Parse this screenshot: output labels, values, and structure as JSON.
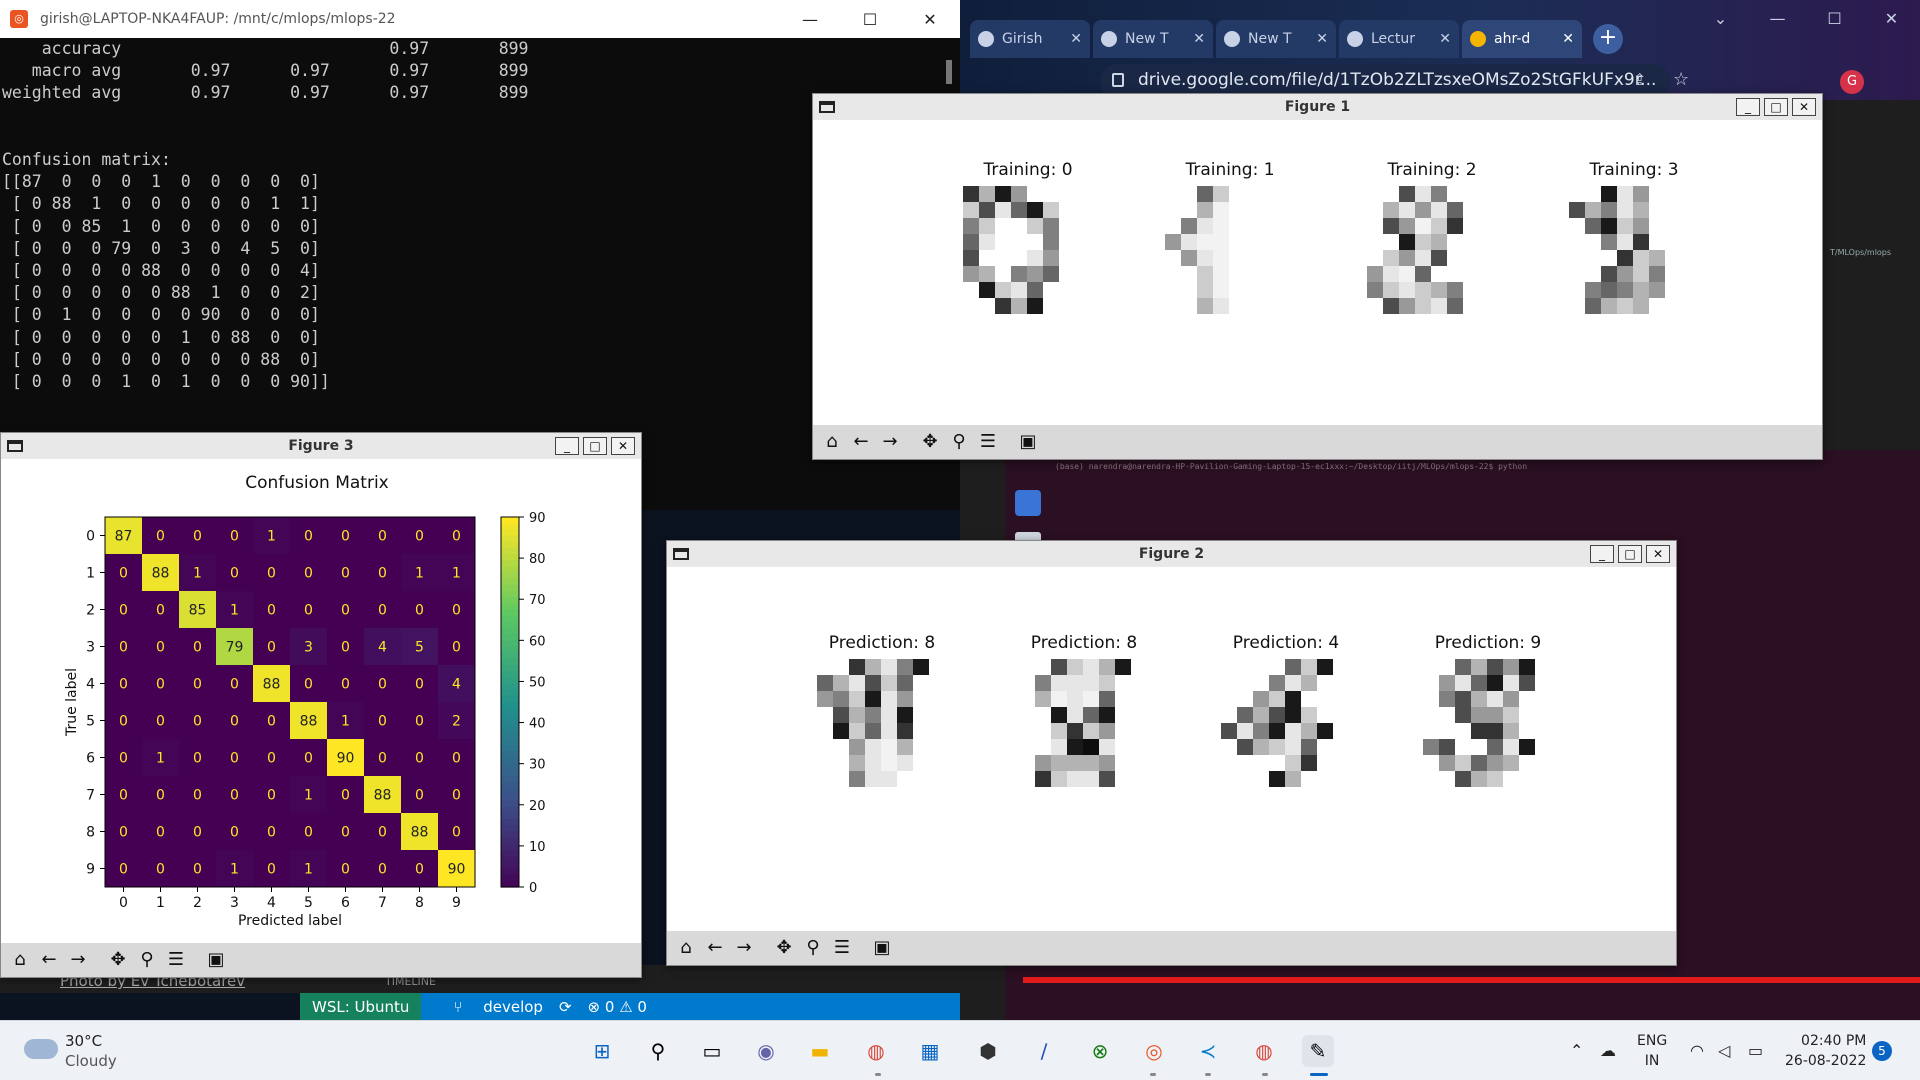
{
  "terminal": {
    "title": "girish@LAPTOP-NKA4FAUP: /mnt/c/mlops/mlops-22",
    "lines": [
      "    accuracy                           0.97       899",
      "   macro avg       0.97      0.97      0.97       899",
      "weighted avg       0.97      0.97      0.97       899",
      "",
      "",
      "Confusion matrix:",
      "[[87  0  0  0  1  0  0  0  0  0]",
      " [ 0 88  1  0  0  0  0  0  1  1]",
      " [ 0  0 85  1  0  0  0  0  0  0]",
      " [ 0  0  0 79  0  3  0  4  5  0]",
      " [ 0  0  0  0 88  0  0  0  0  4]",
      " [ 0  0  0  0  0 88  1  0  0  2]",
      " [ 0  1  0  0  0  0 90  0  0  0]",
      " [ 0  0  0  0  0  1  0 88  0  0]",
      " [ 0  0  0  0  0  0  0  0 88  0]",
      " [ 0  0  0  1  0  1  0  0  0 90]]"
    ]
  },
  "browser": {
    "tabs": [
      {
        "label": "Girish",
        "icon": "github-icon"
      },
      {
        "label": "New T",
        "icon": "chrome-icon"
      },
      {
        "label": "New T",
        "icon": "chrome-icon"
      },
      {
        "label": "Lectur",
        "icon": "classroom-icon"
      },
      {
        "label": "ahr-d",
        "icon": "drive-icon"
      }
    ],
    "url": "drive.google.com/file/d/1TzOb2ZLTzsxeOMsZo2StGFkUFx9r...",
    "profile_initial": "G"
  },
  "figure1": {
    "title": "Figure 1",
    "panels": [
      "Training: 0",
      "Training: 1",
      "Training: 2",
      "Training: 3"
    ]
  },
  "figure2": {
    "title": "Figure 2",
    "panels": [
      "Prediction: 8",
      "Prediction: 8",
      "Prediction: 4",
      "Prediction: 9"
    ]
  },
  "figure3": {
    "title": "Figure 3"
  },
  "chart_data": {
    "type": "heatmap",
    "title": "Confusion Matrix",
    "xlabel": "Predicted label",
    "ylabel": "True label",
    "x_ticks": [
      "0",
      "1",
      "2",
      "3",
      "4",
      "5",
      "6",
      "7",
      "8",
      "9"
    ],
    "y_ticks": [
      "0",
      "1",
      "2",
      "3",
      "4",
      "5",
      "6",
      "7",
      "8",
      "9"
    ],
    "values": [
      [
        87,
        0,
        0,
        0,
        1,
        0,
        0,
        0,
        0,
        0
      ],
      [
        0,
        88,
        1,
        0,
        0,
        0,
        0,
        0,
        1,
        1
      ],
      [
        0,
        0,
        85,
        1,
        0,
        0,
        0,
        0,
        0,
        0
      ],
      [
        0,
        0,
        0,
        79,
        0,
        3,
        0,
        4,
        5,
        0
      ],
      [
        0,
        0,
        0,
        0,
        88,
        0,
        0,
        0,
        0,
        4
      ],
      [
        0,
        0,
        0,
        0,
        0,
        88,
        1,
        0,
        0,
        2
      ],
      [
        0,
        1,
        0,
        0,
        0,
        0,
        90,
        0,
        0,
        0
      ],
      [
        0,
        0,
        0,
        0,
        0,
        1,
        0,
        88,
        0,
        0
      ],
      [
        0,
        0,
        0,
        0,
        0,
        0,
        0,
        0,
        88,
        0
      ],
      [
        0,
        0,
        0,
        1,
        0,
        1,
        0,
        0,
        0,
        90
      ]
    ],
    "colorbar_ticks": [
      0,
      10,
      20,
      30,
      40,
      50,
      60,
      70,
      80,
      90
    ],
    "colorbar_range": [
      0,
      90
    ],
    "colormap": "viridis"
  },
  "vscode": {
    "wsl_label": "WSL: Ubuntu",
    "branch": "develop",
    "problems": "⊗ 0 ⚠ 0",
    "timeline": "TIMELINE",
    "photo_credit": "Photo by Ev Tchebotarev"
  },
  "ubuntu_terminal": {
    "prompt": "(base) narendra@narendra-HP-Pavilion-Gaming-Laptop-15-ec1xxx:~/Desktop/iitj/MLOps/mlops-22$ python"
  },
  "right_strip_text": "T/MLOps/mlops",
  "taskbar": {
    "temperature": "30°C",
    "weather": "Cloudy",
    "lang_line1": "ENG",
    "lang_line2": "IN",
    "time": "02:40 PM",
    "date": "26-08-2022",
    "notification_count": "5"
  },
  "colors": {
    "terminal_bg": "#0c0c0c",
    "vscode_blue": "#007acc",
    "wsl_green": "#16825d",
    "red_bar": "#e21a1a"
  }
}
